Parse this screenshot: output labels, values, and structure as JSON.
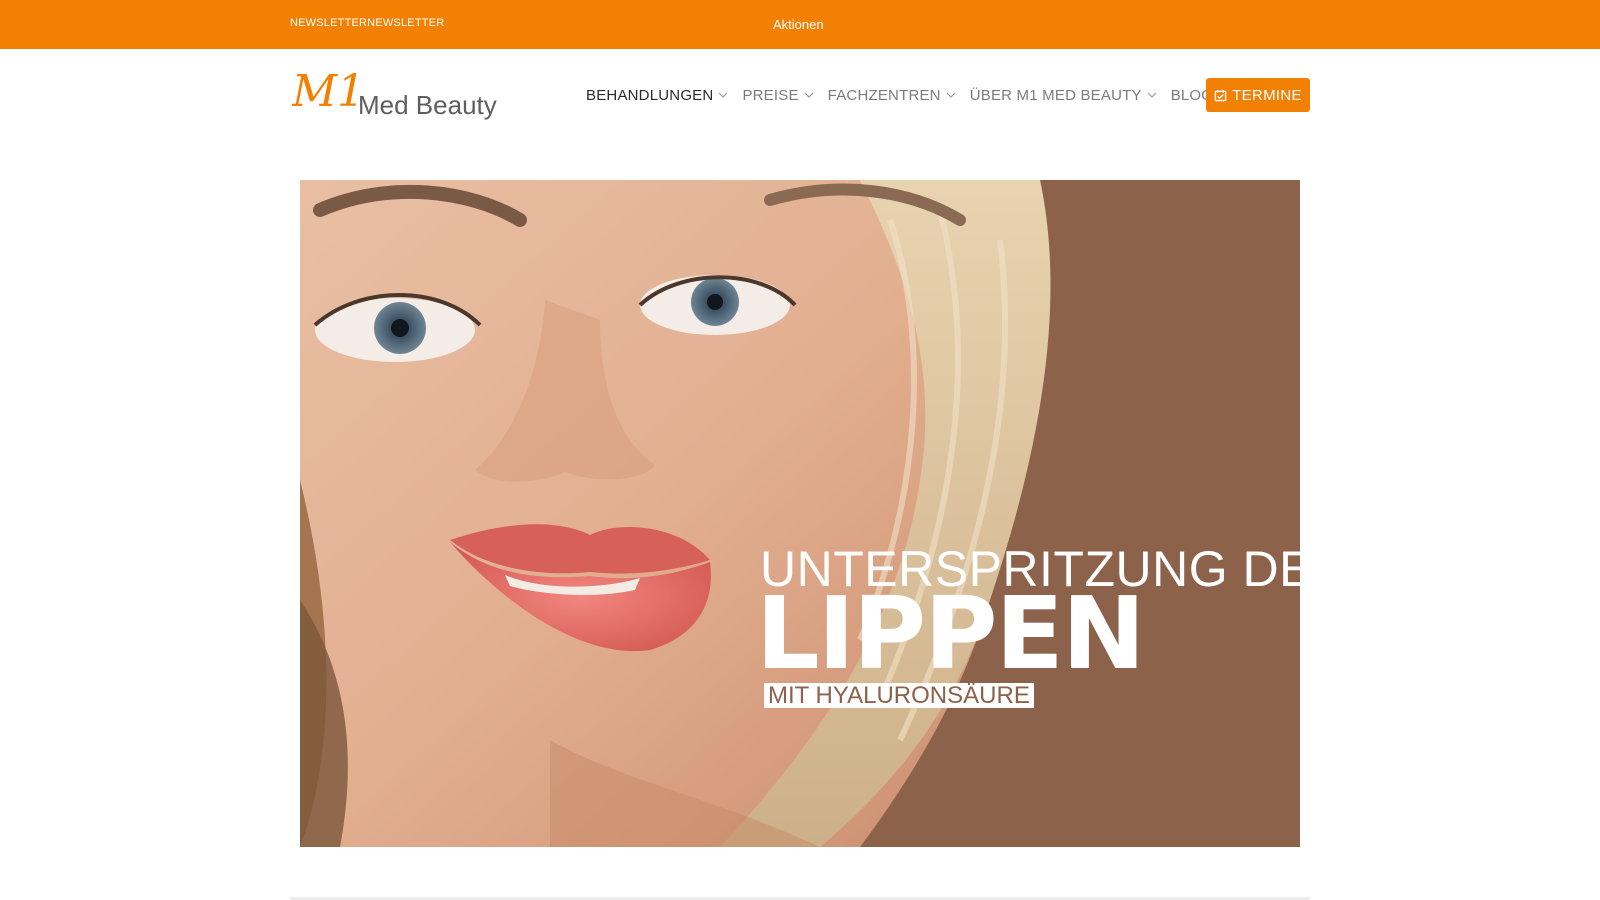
{
  "topbar": {
    "newsletter_label": "NEWSLETTERNEWSLETTER",
    "aktionen_label": "Aktionen"
  },
  "logo": {
    "mark": "M1",
    "name": "Med Beauty"
  },
  "nav": {
    "items": [
      {
        "label": "BEHANDLUNGEN",
        "dropdown": true,
        "active": true
      },
      {
        "label": "PREISE",
        "dropdown": true
      },
      {
        "label": "FACHZENTREN",
        "dropdown": true
      },
      {
        "label": "ÜBER M1 MED BEAUTY",
        "dropdown": true
      },
      {
        "label": "BLOG",
        "dropdown": false
      }
    ],
    "cta_label": "TERMINE"
  },
  "hero": {
    "line1": "UNTERSPRITZUNG DER",
    "line2": "LIPPEN",
    "line3": "MIT HYALURONSÄURE"
  },
  "colors": {
    "brand_orange": "#f28003",
    "hero_background": "#8d624b"
  },
  "icons": [
    "chevron-down-icon",
    "calendar-check-icon"
  ]
}
